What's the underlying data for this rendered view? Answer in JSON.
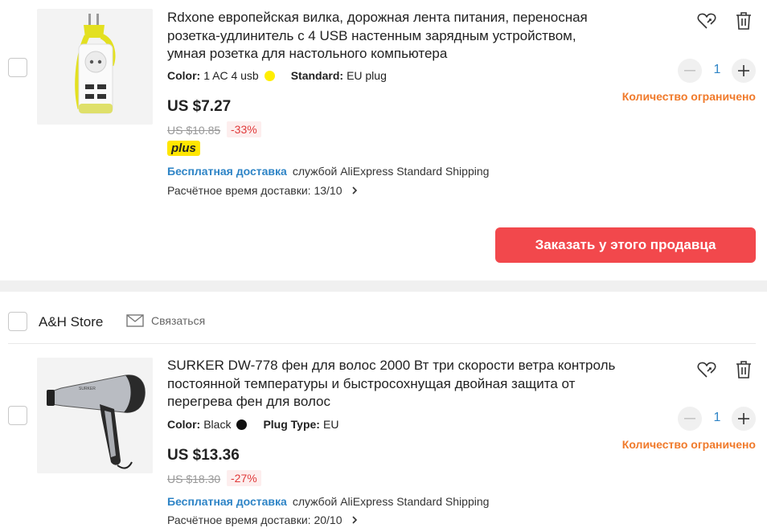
{
  "items": [
    {
      "title": "Rdxone европейская вилка, дорожная лента питания, переносная розетка-удлинитель с 4 USB настенным зарядным устройством, умная розетка для настольного компьютера",
      "attr1_label": "Color:",
      "attr1_value": "1 AC 4 usb",
      "attr1_swatch_color": "#ffee00",
      "attr2_label": "Standard:",
      "attr2_value": "EU plug",
      "price": "US $7.27",
      "old_price": "US $10.85",
      "discount": "-33%",
      "badge": "plus",
      "free_shipping": "Бесплатная доставка",
      "shipping_method": "службой AliExpress Standard Shipping",
      "eta": "Расчётное время доставки: 13/10",
      "quantity": "1",
      "limited": "Количество ограничено"
    },
    {
      "title": "SURKER DW-778 фен для волос 2000 Вт три скорости ветра контроль постоянной температуры и быстросохнущая двойная защита от перегрева фен для волос",
      "attr1_label": "Color:",
      "attr1_value": "Black",
      "attr1_swatch_color": "#111111",
      "attr2_label": "Plug Type:",
      "attr2_value": "EU",
      "price": "US $13.36",
      "old_price": "US $18.30",
      "discount": "-27%",
      "free_shipping": "Бесплатная доставка",
      "shipping_method": "службой AliExpress Standard Shipping",
      "eta": "Расчётное время доставки: 20/10",
      "quantity": "1",
      "limited": "Количество ограничено"
    }
  ],
  "order_button": "Заказать у этого продавца",
  "store": {
    "name": "A&H Store",
    "contact": "Связаться"
  },
  "colors": {
    "accent_red": "#f2484c",
    "link_blue": "#2e84c6",
    "limited_orange": "#f07a2b",
    "plus_yellow": "#ffe600"
  },
  "icons": [
    "heart-icon",
    "trash-icon",
    "minus-icon",
    "plus-icon",
    "chevron-right-icon",
    "mail-icon"
  ]
}
